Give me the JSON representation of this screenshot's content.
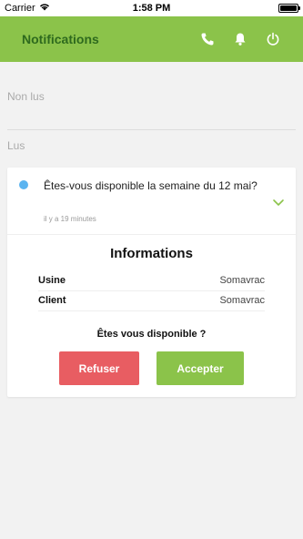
{
  "statusbar": {
    "carrier": "Carrier",
    "time": "1:58 PM",
    "battery_level": 1.0
  },
  "appbar": {
    "title": "Notifications",
    "icons": [
      "phone-icon",
      "bell-icon",
      "power-icon"
    ],
    "color": "#8bc34a",
    "title_color": "#2e6a1e"
  },
  "sections": {
    "unread": "Non lus",
    "read": "Lus"
  },
  "notification": {
    "unread_dot_color": "#5bb4f0",
    "message": "Êtes-vous disponible la semaine du 12 mai?",
    "time_ago": "il y a 19 minutes"
  },
  "details": {
    "title": "Informations",
    "rows": [
      {
        "label": "Usine",
        "value": "Somavrac"
      },
      {
        "label": "Client",
        "value": "Somavrac"
      }
    ],
    "question": "Êtes vous disponible ?"
  },
  "actions": {
    "refuse_label": "Refuser",
    "refuse_color": "#e85d62",
    "accept_label": "Accepter",
    "accept_color": "#8bc34a"
  }
}
